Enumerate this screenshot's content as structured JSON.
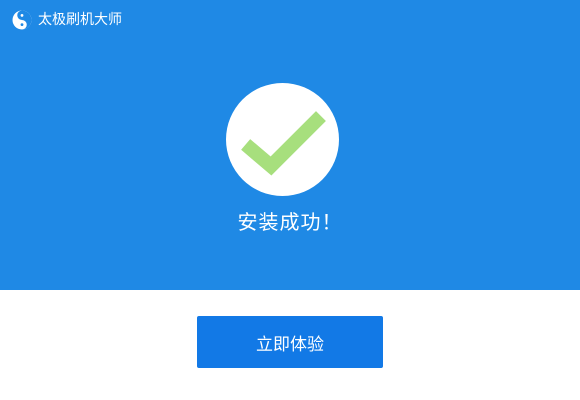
{
  "window": {
    "title": "太极刷机大师",
    "logo_icon": "taiji-logo-icon"
  },
  "status": {
    "icon": "checkmark-icon",
    "message": "安装成功！"
  },
  "actions": {
    "primary_label": "立即体验"
  },
  "colors": {
    "header_background": "#1f89e5",
    "button_background": "#1279e6",
    "checkmark": "#a7df7d",
    "text_on_blue": "#ffffff"
  }
}
